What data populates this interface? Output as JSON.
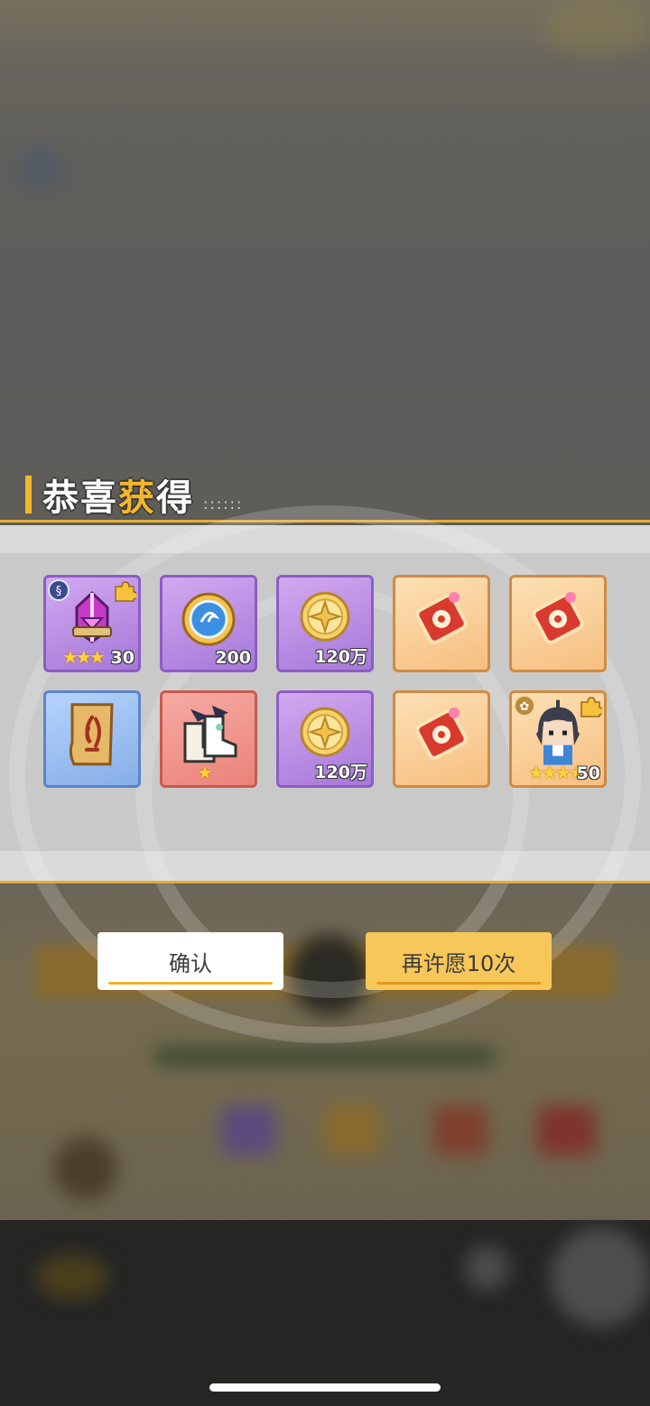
{
  "title": {
    "prefix": "恭喜",
    "highlight": "获",
    "suffix": "得",
    "dots": "::::::"
  },
  "items": [
    {
      "name": "helmet",
      "rarity": "purple",
      "quantity": "30",
      "stars": "★★★",
      "badge_left": "element",
      "badge_right": true
    },
    {
      "name": "blue-orb",
      "rarity": "purple",
      "quantity": "200",
      "stars": "",
      "badge_left": "",
      "badge_right": false
    },
    {
      "name": "gold-coin",
      "rarity": "purple",
      "quantity": "120万",
      "stars": "",
      "badge_left": "",
      "badge_right": false
    },
    {
      "name": "red-ticket",
      "rarity": "orange",
      "quantity": "",
      "stars": "",
      "badge_left": "",
      "badge_right": false
    },
    {
      "name": "red-ticket",
      "rarity": "orange",
      "quantity": "",
      "stars": "",
      "badge_left": "",
      "badge_right": false
    },
    {
      "name": "fire-scroll",
      "rarity": "blue",
      "quantity": "",
      "stars": "",
      "badge_left": "",
      "badge_right": false
    },
    {
      "name": "boots",
      "rarity": "red",
      "quantity": "",
      "stars": "★",
      "badge_left": "",
      "badge_right": false
    },
    {
      "name": "gold-coin",
      "rarity": "purple",
      "quantity": "120万",
      "stars": "",
      "badge_left": "",
      "badge_right": false
    },
    {
      "name": "red-ticket",
      "rarity": "orange",
      "quantity": "",
      "stars": "",
      "badge_left": "",
      "badge_right": false
    },
    {
      "name": "character",
      "rarity": "orange",
      "quantity": "50",
      "stars": "★★★★",
      "badge_left": "lotus",
      "badge_right": true
    }
  ],
  "buttons": {
    "confirm": "确认",
    "wish_again": "再许愿10次"
  },
  "colors": {
    "accent": "#f4b62a",
    "line": "#e2ae3a",
    "confirm_bg": "#ffffff",
    "again_bg": "#f7c75a"
  }
}
